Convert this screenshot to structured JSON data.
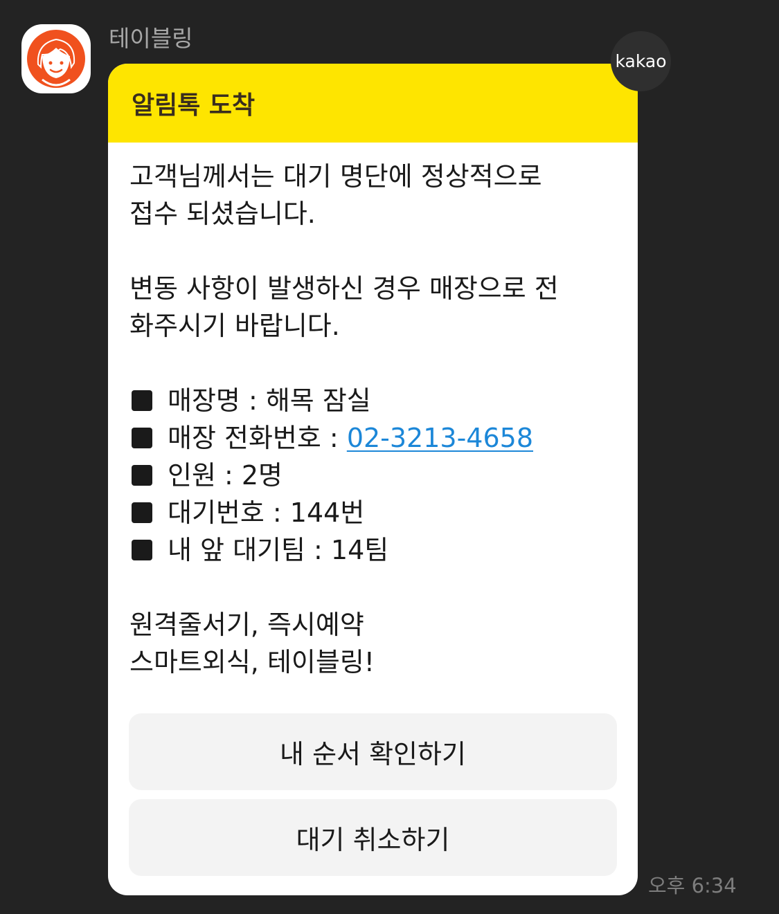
{
  "sender": {
    "name": "테이블링",
    "avatar_icon": "person-face-avatar-icon",
    "avatar_color": "#f0511e"
  },
  "badge": {
    "label": "kakao"
  },
  "card": {
    "header_title": "알림톡 도착",
    "header_color": "#fee500",
    "paragraph_1": "고객님께서는 대기 명단에 정상적으로\n접수 되셨습니다.",
    "paragraph_2": "변동 사항이 발생하신 경우 매장으로 전\n화주시기 바랍니다.",
    "info": {
      "store_name": "매장명 : 해목 잠실",
      "store_phone_label": "매장 전화번호 : ",
      "store_phone": "02-3213-4658",
      "party_size": "인원 : 2명",
      "wait_number": "대기번호 : 144번",
      "teams_ahead": "내 앞 대기팀 : 14팀"
    },
    "closing": "원격줄서기, 즉시예약\n스마트외식, 테이블링!",
    "buttons": {
      "check_order": "내 순서 확인하기",
      "cancel_wait": "대기 취소하기"
    },
    "link_color": "#1c87d8"
  },
  "timestamp": "오후 6:34"
}
